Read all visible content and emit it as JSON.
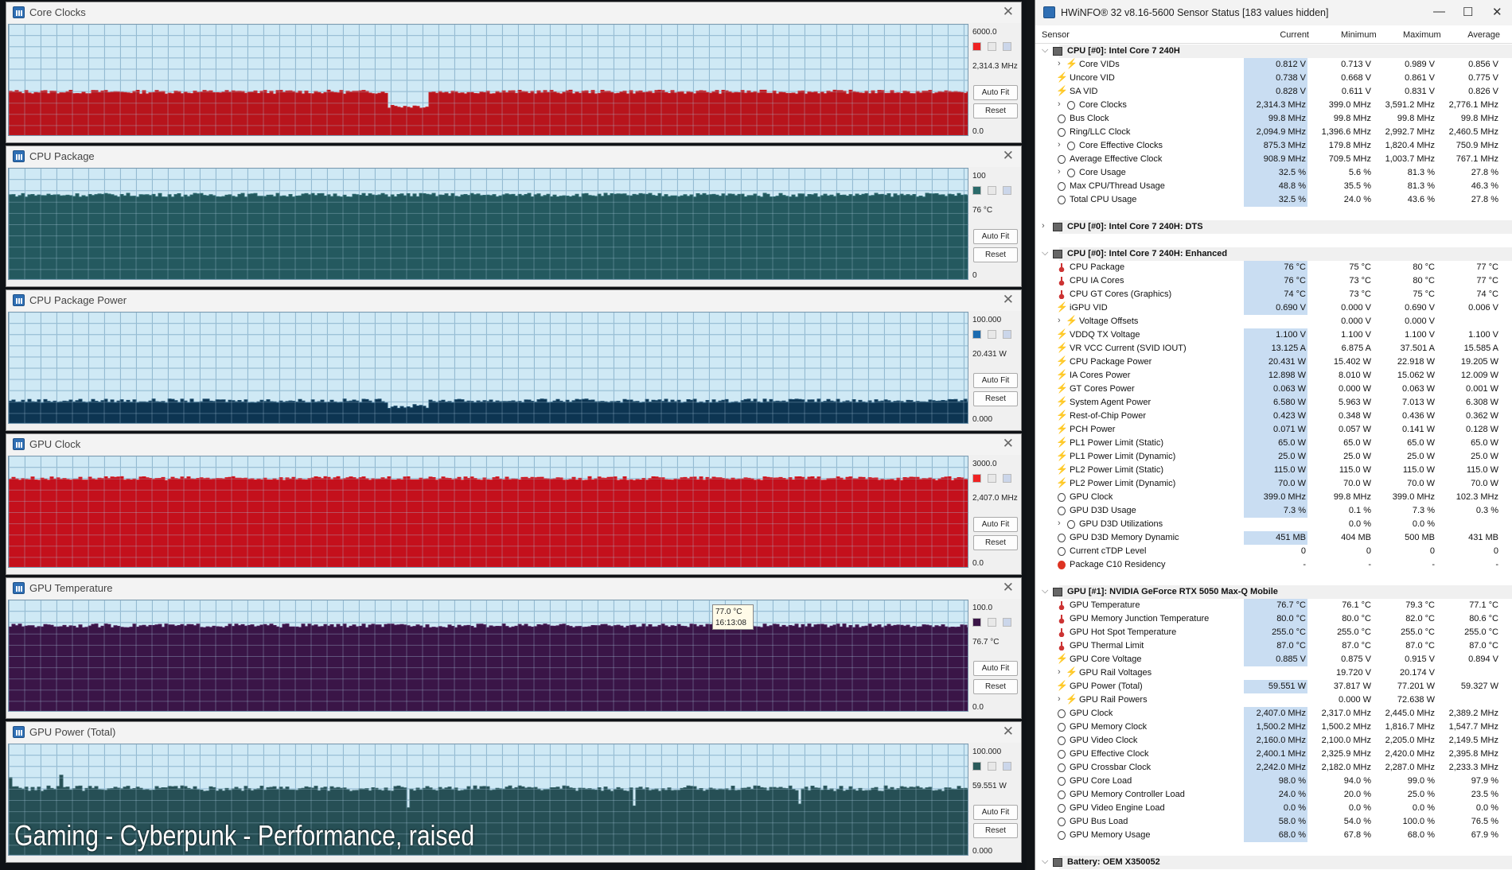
{
  "graphs": [
    {
      "title": "Core Clocks",
      "max": "6000.0",
      "current": "2,314.3 MHz",
      "min": "0.0",
      "color": "#b8141c",
      "top_color": "#c81e24",
      "level": 0.39,
      "profile": "dip",
      "swatch": "#e22"
    },
    {
      "title": "CPU Package",
      "max": "100",
      "current": "76 °C",
      "min": "0",
      "color": "#24595f",
      "top_color": "#2c6a70",
      "level": 0.76,
      "profile": "flat",
      "swatch": "#2a6a6a"
    },
    {
      "title": "CPU Package Power",
      "max": "100.000",
      "current": "20.431 W",
      "min": "0.000",
      "color": "#0d3552",
      "top_color": "#1a4a6b",
      "level": 0.2,
      "profile": "dip",
      "swatch": "#1b6bb0"
    },
    {
      "title": "GPU Clock",
      "max": "3000.0",
      "current": "2,407.0 MHz",
      "min": "0.0",
      "color": "#c4101c",
      "top_color": "#d81820",
      "level": 0.8,
      "profile": "flat",
      "swatch": "#e22"
    },
    {
      "title": "GPU Temperature",
      "max": "100.0",
      "current": "76.7 °C",
      "min": "0.0",
      "color": "#3a1547",
      "top_color": "#4a1d58",
      "level": 0.77,
      "profile": "flat",
      "swatch": "#3a1547"
    },
    {
      "title": "GPU Power (Total)",
      "max": "100.000",
      "current": "59.551 W",
      "min": "0.000",
      "color": "#264f55",
      "top_color": "#336066",
      "level": 0.6,
      "profile": "noisy",
      "swatch": "#2a5a5a"
    }
  ],
  "buttons": {
    "auto_fit": "Auto Fit",
    "reset": "Reset"
  },
  "tooltip": {
    "value": "77.0 °C",
    "time": "16:13:08"
  },
  "overlay_text": "Gaming - Cyberpunk - Performance, raised",
  "sensor_window": {
    "title": "HWiNFO® 32 v8.16-5600 Sensor Status [183 values hidden]",
    "columns": [
      "Sensor",
      "Current",
      "Minimum",
      "Maximum",
      "Average"
    ],
    "rows": [
      {
        "type": "group",
        "name": "CPU [#0]: Intel Core 7 240H",
        "open": true
      },
      {
        "icon": "bolt",
        "name": "Core VIDs",
        "sub": true,
        "vals": [
          "0.812 V",
          "0.713 V",
          "0.989 V",
          "0.856 V"
        ]
      },
      {
        "icon": "bolt",
        "name": "Uncore VID",
        "vals": [
          "0.738 V",
          "0.668 V",
          "0.861 V",
          "0.775 V"
        ]
      },
      {
        "icon": "bolt",
        "name": "SA VID",
        "vals": [
          "0.828 V",
          "0.611 V",
          "0.831 V",
          "0.826 V"
        ]
      },
      {
        "icon": "clock",
        "name": "Core Clocks",
        "sub": true,
        "vals": [
          "2,314.3 MHz",
          "399.0 MHz",
          "3,591.2 MHz",
          "2,776.1 MHz"
        ]
      },
      {
        "icon": "clock",
        "name": "Bus Clock",
        "vals": [
          "99.8 MHz",
          "99.8 MHz",
          "99.8 MHz",
          "99.8 MHz"
        ]
      },
      {
        "icon": "clock",
        "name": "Ring/LLC Clock",
        "vals": [
          "2,094.9 MHz",
          "1,396.6 MHz",
          "2,992.7 MHz",
          "2,460.5 MHz"
        ]
      },
      {
        "icon": "clock",
        "name": "Core Effective Clocks",
        "sub": true,
        "vals": [
          "875.3 MHz",
          "179.8 MHz",
          "1,820.4 MHz",
          "750.9 MHz"
        ]
      },
      {
        "icon": "clock",
        "name": "Average Effective Clock",
        "vals": [
          "908.9 MHz",
          "709.5 MHz",
          "1,003.7 MHz",
          "767.1 MHz"
        ]
      },
      {
        "icon": "clock",
        "name": "Core Usage",
        "sub": true,
        "vals": [
          "32.5 %",
          "5.6 %",
          "81.3 %",
          "27.8 %"
        ]
      },
      {
        "icon": "clock",
        "name": "Max CPU/Thread Usage",
        "vals": [
          "48.8 %",
          "35.5 %",
          "81.3 %",
          "46.3 %"
        ]
      },
      {
        "icon": "clock",
        "name": "Total CPU Usage",
        "vals": [
          "32.5 %",
          "24.0 %",
          "43.6 %",
          "27.8 %"
        ]
      },
      {
        "type": "blank"
      },
      {
        "type": "group",
        "name": "CPU [#0]: Intel Core 7 240H: DTS",
        "open": false
      },
      {
        "type": "blank"
      },
      {
        "type": "group",
        "name": "CPU [#0]: Intel Core 7 240H: Enhanced",
        "open": true
      },
      {
        "icon": "therm",
        "name": "CPU Package",
        "vals": [
          "76 °C",
          "75 °C",
          "80 °C",
          "77 °C"
        ]
      },
      {
        "icon": "therm",
        "name": "CPU IA Cores",
        "vals": [
          "76 °C",
          "73 °C",
          "80 °C",
          "77 °C"
        ]
      },
      {
        "icon": "therm",
        "name": "CPU GT Cores (Graphics)",
        "vals": [
          "74 °C",
          "73 °C",
          "75 °C",
          "74 °C"
        ]
      },
      {
        "icon": "bolt",
        "name": "iGPU VID",
        "vals": [
          "0.690 V",
          "0.000 V",
          "0.690 V",
          "0.006 V"
        ]
      },
      {
        "icon": "bolt",
        "name": "Voltage Offsets",
        "sub": true,
        "vals": [
          "",
          "0.000 V",
          "0.000 V",
          ""
        ]
      },
      {
        "icon": "bolt",
        "name": "VDDQ TX Voltage",
        "vals": [
          "1.100 V",
          "1.100 V",
          "1.100 V",
          "1.100 V"
        ]
      },
      {
        "icon": "bolt",
        "name": "VR VCC Current (SVID IOUT)",
        "vals": [
          "13.125 A",
          "6.875 A",
          "37.501 A",
          "15.585 A"
        ]
      },
      {
        "icon": "bolt",
        "name": "CPU Package Power",
        "vals": [
          "20.431 W",
          "15.402 W",
          "22.918 W",
          "19.205 W"
        ]
      },
      {
        "icon": "bolt",
        "name": "IA Cores Power",
        "vals": [
          "12.898 W",
          "8.010 W",
          "15.062 W",
          "12.009 W"
        ]
      },
      {
        "icon": "bolt",
        "name": "GT Cores Power",
        "vals": [
          "0.063 W",
          "0.000 W",
          "0.063 W",
          "0.001 W"
        ]
      },
      {
        "icon": "bolt",
        "name": "System Agent Power",
        "vals": [
          "6.580 W",
          "5.963 W",
          "7.013 W",
          "6.308 W"
        ]
      },
      {
        "icon": "bolt",
        "name": "Rest-of-Chip Power",
        "vals": [
          "0.423 W",
          "0.348 W",
          "0.436 W",
          "0.362 W"
        ]
      },
      {
        "icon": "bolt",
        "name": "PCH Power",
        "vals": [
          "0.071 W",
          "0.057 W",
          "0.141 W",
          "0.128 W"
        ]
      },
      {
        "icon": "bolt",
        "name": "PL1 Power Limit (Static)",
        "vals": [
          "65.0 W",
          "65.0 W",
          "65.0 W",
          "65.0 W"
        ]
      },
      {
        "icon": "bolt",
        "name": "PL1 Power Limit (Dynamic)",
        "vals": [
          "25.0 W",
          "25.0 W",
          "25.0 W",
          "25.0 W"
        ]
      },
      {
        "icon": "bolt",
        "name": "PL2 Power Limit (Static)",
        "vals": [
          "115.0 W",
          "115.0 W",
          "115.0 W",
          "115.0 W"
        ]
      },
      {
        "icon": "bolt",
        "name": "PL2 Power Limit (Dynamic)",
        "vals": [
          "70.0 W",
          "70.0 W",
          "70.0 W",
          "70.0 W"
        ]
      },
      {
        "icon": "clock",
        "name": "GPU Clock",
        "vals": [
          "399.0 MHz",
          "99.8 MHz",
          "399.0 MHz",
          "102.3 MHz"
        ]
      },
      {
        "icon": "clock",
        "name": "GPU D3D Usage",
        "vals": [
          "7.3 %",
          "0.1 %",
          "7.3 %",
          "0.3 %"
        ]
      },
      {
        "icon": "clock",
        "name": "GPU D3D Utilizations",
        "sub": true,
        "vals": [
          "",
          "0.0 %",
          "0.0 %",
          ""
        ]
      },
      {
        "icon": "clock",
        "name": "GPU D3D Memory Dynamic",
        "vals": [
          "451 MB",
          "404 MB",
          "500 MB",
          "431 MB"
        ]
      },
      {
        "icon": "clock",
        "name": "Current cTDP Level",
        "vals": [
          "0",
          "0",
          "0",
          "0"
        ]
      },
      {
        "icon": "err",
        "name": "Package C10 Residency",
        "vals": [
          "-",
          "-",
          "-",
          "-"
        ]
      },
      {
        "type": "blank"
      },
      {
        "type": "group",
        "name": "GPU [#1]: NVIDIA  GeForce RTX 5050 Max-Q Mobile",
        "open": true
      },
      {
        "icon": "therm",
        "name": "GPU Temperature",
        "vals": [
          "76.7 °C",
          "76.1 °C",
          "79.3 °C",
          "77.1 °C"
        ]
      },
      {
        "icon": "therm",
        "name": "GPU Memory Junction Temperature",
        "vals": [
          "80.0 °C",
          "80.0 °C",
          "82.0 °C",
          "80.6 °C"
        ]
      },
      {
        "icon": "therm",
        "name": "GPU Hot Spot Temperature",
        "vals": [
          "255.0 °C",
          "255.0 °C",
          "255.0 °C",
          "255.0 °C"
        ]
      },
      {
        "icon": "therm",
        "name": "GPU Thermal Limit",
        "vals": [
          "87.0 °C",
          "87.0 °C",
          "87.0 °C",
          "87.0 °C"
        ]
      },
      {
        "icon": "bolt",
        "name": "GPU Core Voltage",
        "vals": [
          "0.885 V",
          "0.875 V",
          "0.915 V",
          "0.894 V"
        ]
      },
      {
        "icon": "bolt",
        "name": "GPU Rail Voltages",
        "sub": true,
        "vals": [
          "",
          "19.720 V",
          "20.174 V",
          ""
        ]
      },
      {
        "icon": "bolt",
        "name": "GPU Power (Total)",
        "vals": [
          "59.551 W",
          "37.817 W",
          "77.201 W",
          "59.327 W"
        ]
      },
      {
        "icon": "bolt",
        "name": "GPU Rail Powers",
        "sub": true,
        "vals": [
          "",
          "0.000 W",
          "72.638 W",
          ""
        ]
      },
      {
        "icon": "clock",
        "name": "GPU Clock",
        "vals": [
          "2,407.0 MHz",
          "2,317.0 MHz",
          "2,445.0 MHz",
          "2,389.2 MHz"
        ]
      },
      {
        "icon": "clock",
        "name": "GPU Memory Clock",
        "vals": [
          "1,500.2 MHz",
          "1,500.2 MHz",
          "1,816.7 MHz",
          "1,547.7 MHz"
        ]
      },
      {
        "icon": "clock",
        "name": "GPU Video Clock",
        "vals": [
          "2,160.0 MHz",
          "2,100.0 MHz",
          "2,205.0 MHz",
          "2,149.5 MHz"
        ]
      },
      {
        "icon": "clock",
        "name": "GPU Effective Clock",
        "vals": [
          "2,400.1 MHz",
          "2,325.9 MHz",
          "2,420.0 MHz",
          "2,395.8 MHz"
        ]
      },
      {
        "icon": "clock",
        "name": "GPU Crossbar Clock",
        "vals": [
          "2,242.0 MHz",
          "2,182.0 MHz",
          "2,287.0 MHz",
          "2,233.3 MHz"
        ]
      },
      {
        "icon": "clock",
        "name": "GPU Core Load",
        "vals": [
          "98.0 %",
          "94.0 %",
          "99.0 %",
          "97.9 %"
        ]
      },
      {
        "icon": "clock",
        "name": "GPU Memory Controller Load",
        "vals": [
          "24.0 %",
          "20.0 %",
          "25.0 %",
          "23.5 %"
        ]
      },
      {
        "icon": "clock",
        "name": "GPU Video Engine Load",
        "vals": [
          "0.0 %",
          "0.0 %",
          "0.0 %",
          "0.0 %"
        ]
      },
      {
        "icon": "clock",
        "name": "GPU Bus Load",
        "vals": [
          "58.0 %",
          "54.0 %",
          "100.0 %",
          "76.5 %"
        ]
      },
      {
        "icon": "clock",
        "name": "GPU Memory Usage",
        "vals": [
          "68.0 %",
          "67.8 %",
          "68.0 %",
          "67.9 %"
        ]
      },
      {
        "type": "blank"
      },
      {
        "type": "group",
        "name": "Battery: OEM X350052",
        "open": true
      }
    ]
  }
}
